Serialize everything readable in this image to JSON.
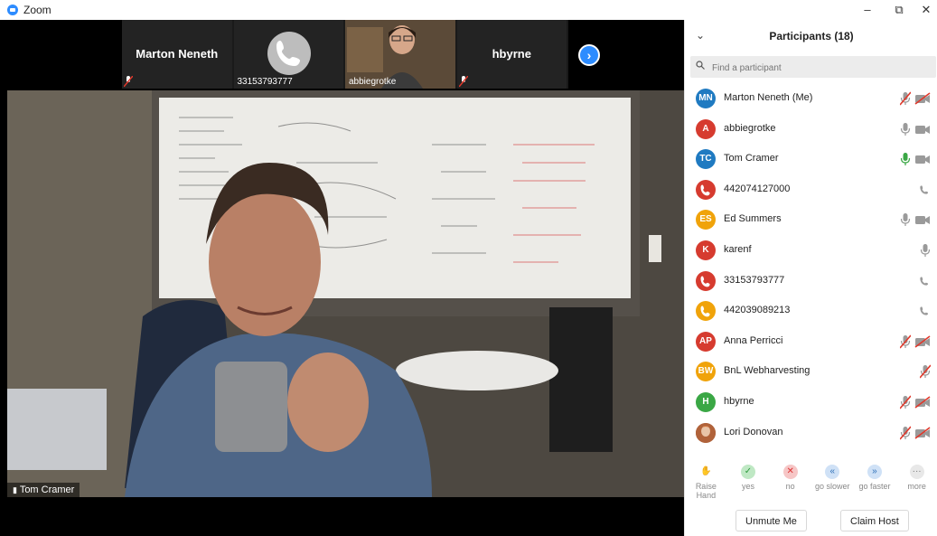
{
  "window": {
    "title": "Zoom",
    "minimize": "–",
    "restore": "⧉",
    "close": "✕"
  },
  "thumbnails": [
    {
      "name": "Marton Neneth",
      "muted": true
    },
    {
      "name": "33153793777",
      "type": "phone"
    },
    {
      "name": "abbiegrotke",
      "type": "video"
    },
    {
      "name": "hbyrne",
      "muted": true
    }
  ],
  "next_page_icon": "›",
  "main_video": {
    "speaker": "Tom Cramer"
  },
  "panel": {
    "title": "Participants (18)",
    "collapse_icon": "⌄",
    "search_placeholder": "Find a participant",
    "participants": [
      {
        "initials": "MN",
        "name": "Marton Neneth (Me)",
        "color": "#1f7ac1",
        "mic": "muted",
        "video": "off"
      },
      {
        "initials": "A",
        "name": "abbiegrotke",
        "color": "#d63b2f",
        "mic": "on",
        "video": "on"
      },
      {
        "initials": "TC",
        "name": "Tom Cramer",
        "color": "#1f7ac1",
        "mic": "speaking",
        "video": "on"
      },
      {
        "initials": "",
        "name": "442074127000",
        "color": "#d63b2f",
        "mic": "phone",
        "video": ""
      },
      {
        "initials": "ES",
        "name": "Ed Summers",
        "color": "#f0a30a",
        "mic": "on",
        "video": "on"
      },
      {
        "initials": "K",
        "name": "karenf",
        "color": "#d63b2f",
        "mic": "on",
        "video": ""
      },
      {
        "initials": "",
        "name": "33153793777",
        "color": "#d63b2f",
        "mic": "phone",
        "video": ""
      },
      {
        "initials": "",
        "name": "442039089213",
        "color": "#f0a30a",
        "mic": "phone",
        "video": ""
      },
      {
        "initials": "AP",
        "name": "Anna Perricci",
        "color": "#d63b2f",
        "mic": "muted",
        "video": "off"
      },
      {
        "initials": "BW",
        "name": "BnL Webharvesting",
        "color": "#f0a30a",
        "mic": "muted",
        "video": ""
      },
      {
        "initials": "H",
        "name": "hbyrne",
        "color": "#3aa745",
        "mic": "muted",
        "video": "off"
      },
      {
        "initials": "",
        "name": "Lori Donovan",
        "color": "#b0623a",
        "mic": "muted",
        "video": "off"
      }
    ],
    "reactions": [
      {
        "label": "Raise Hand",
        "icon": "✋",
        "color": "#ffffff",
        "fg": "#e3a060"
      },
      {
        "label": "yes",
        "icon": "✓",
        "color": "#bfe8c4",
        "fg": "#2e9b3e"
      },
      {
        "label": "no",
        "icon": "✕",
        "color": "#f6c6c6",
        "fg": "#d33"
      },
      {
        "label": "go slower",
        "icon": "«",
        "color": "#cfe1f6",
        "fg": "#2d6fb7"
      },
      {
        "label": "go faster",
        "icon": "»",
        "color": "#cfe1f6",
        "fg": "#2d6fb7"
      },
      {
        "label": "more",
        "icon": "···",
        "color": "#e8e8e8",
        "fg": "#777"
      }
    ],
    "unmute_label": "Unmute Me",
    "claim_host_label": "Claim Host"
  }
}
